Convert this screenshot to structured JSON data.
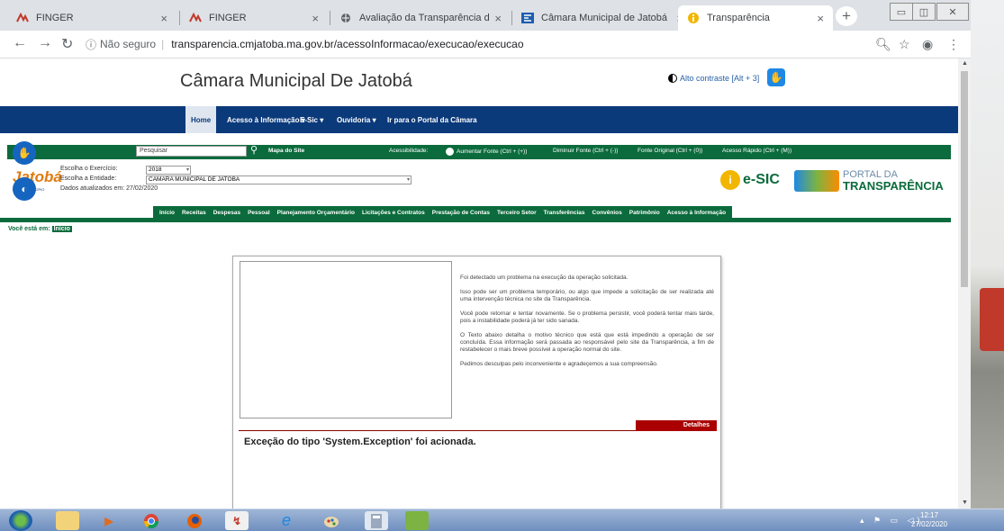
{
  "browser": {
    "tabs": [
      {
        "title": "FINGER",
        "icon": "finger-favicon-icon"
      },
      {
        "title": "FINGER",
        "icon": "finger-favicon-icon"
      },
      {
        "title": "Avaliação da Transparência dos",
        "icon": "globe-icon"
      },
      {
        "title": "Câmara Municipal de Jatobá",
        "icon": "site-favicon-icon"
      },
      {
        "title": "Transparência",
        "icon": "info-favicon-icon"
      }
    ],
    "security_label": "Não seguro",
    "url": "transparencia.cmjatoba.ma.gov.br/acessoInformacao/execucao/execucao"
  },
  "site": {
    "title": "Câmara Municipal De Jatobá",
    "contrast": "Alto contraste [Alt + 3]",
    "nav": [
      "Home",
      "Acesso à Informação ▾",
      "E-Sic ▾",
      "Ouvidoria ▾",
      "Ir para o Portal da Câmara"
    ]
  },
  "portal": {
    "search_placeholder": "Pesquisar",
    "sitemap": "Mapa do Site",
    "accessibility": "Acessibilidade:",
    "font_increase": "Aumentar Fonte (Ctrl + (+))",
    "font_decrease": "Diminuir Fonte (Ctrl + (-))",
    "font_original": "Fonte Original (Ctrl + (0))",
    "quick_access": "Acesso Rápido (Ctrl + (M))",
    "logo_text": "Jatobá",
    "logo_sub": "ATOBÁ MUNICÍPIO",
    "year_label": "Escolha o Exercício:",
    "year_value": "2018",
    "entity_label": "Escolha a Entidade:",
    "entity_value": "CAMARA MUNICIPAL DE JATOBA",
    "updated": "Dados atualizados em: 27/02/2020",
    "esic": "e-SIC",
    "portal_l1": "PORTAL DA",
    "portal_l2": "TRANSPARÊNCIA",
    "sections": [
      "Início",
      "Receitas",
      "Despesas",
      "Pessoal",
      "Planejamento Orçamentário",
      "Licitações e Contratos",
      "Prestação de Contas",
      "Terceiro Setor",
      "Transferências",
      "Convênios",
      "Patrimônio",
      "Acesso à Informação"
    ],
    "breadcrumb_label": "Você está em:",
    "breadcrumb_current": "Início"
  },
  "error": {
    "p1": "Foi detectado um problema na execução da operação solicitada.",
    "p2": "Isso pode ser um problema temporário, ou algo que impede a solicitação de ser realizada até uma intervenção técnica no site da Transparência.",
    "p3": "Você pode retornar e tentar novamente. Se o problema persistir, você poderá tentar mais tarde, pois a instabilidade poderá já ter sido sanada.",
    "p4": "O Texto abaixo detalha o motivo técnico que está que está impedindo a operação de ser concluída. Essa informação será passada ao responsável pelo site da Transparência, a fim de restabelecer o mais breve possível a operação normal do site.",
    "p5": "Pedimos desculpas pelo inconveniente e agradeçemos a sua compreensão.",
    "details": "Detalhes",
    "exception": "Exceção do tipo 'System.Exception' foi acionada."
  },
  "taskbar": {
    "time": "12:17",
    "date": "27/02/2020"
  },
  "colors": {
    "navy": "#0b3a7b",
    "green": "#0b6b3c",
    "details_red": "#aa0000"
  }
}
